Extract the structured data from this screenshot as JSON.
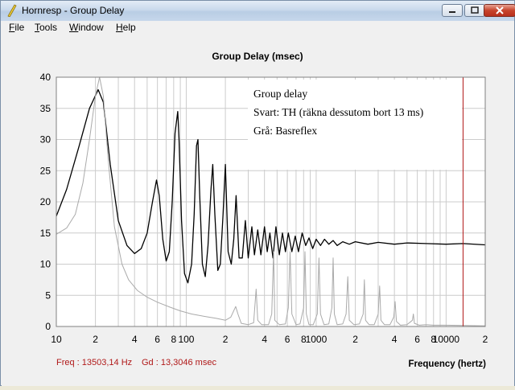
{
  "window": {
    "title": "Hornresp - Group Delay",
    "controls": {
      "minimize": "minimize-icon",
      "maximize": "maximize-icon",
      "close": "close-icon"
    }
  },
  "menu": {
    "file": {
      "label": "File",
      "first": "F",
      "rest": "ile"
    },
    "tools": {
      "label": "Tools",
      "first": "T",
      "rest": "ools"
    },
    "window": {
      "label": "Window",
      "first": "W",
      "rest": "indow"
    },
    "help": {
      "label": "Help",
      "first": "H",
      "rest": "elp"
    }
  },
  "annotation": {
    "line1": "Group delay",
    "line2": "Svart: TH (räkna dessutom bort 13 ms)",
    "line3": "Grå: Basreflex"
  },
  "readout": {
    "freq": "Freq : 13503,14 Hz",
    "gd": "Gd : 13,3046 msec"
  },
  "colors": {
    "plot_bg": "#ffffff",
    "grid": "#cccccc",
    "series_th": "#000000",
    "series_bassreflex": "#aaaaaa",
    "cursor": "#b01818",
    "readout": "#b01818"
  },
  "chart_data": {
    "type": "line",
    "title": "Group Delay (msec)",
    "xlabel": "Frequency (hertz)",
    "ylabel": "",
    "x_scale": "log",
    "xlim": [
      10,
      20000
    ],
    "ylim": [
      0,
      40
    ],
    "grid": true,
    "y_ticks": [
      "0",
      "5",
      "10",
      "15",
      "20",
      "25",
      "30",
      "35",
      "40"
    ],
    "x_tick_labels": [
      {
        "f": 10,
        "label": "10"
      },
      {
        "f": 20,
        "label": "2"
      },
      {
        "f": 40,
        "label": "4"
      },
      {
        "f": 60,
        "label": "6"
      },
      {
        "f": 80,
        "label": "8"
      },
      {
        "f": 100,
        "label": "100"
      },
      {
        "f": 200,
        "label": "2"
      },
      {
        "f": 400,
        "label": "4"
      },
      {
        "f": 600,
        "label": "6"
      },
      {
        "f": 800,
        "label": "8"
      },
      {
        "f": 1000,
        "label": "1000"
      },
      {
        "f": 2000,
        "label": "2"
      },
      {
        "f": 4000,
        "label": "4"
      },
      {
        "f": 6000,
        "label": "6"
      },
      {
        "f": 8000,
        "label": "8"
      },
      {
        "f": 10000,
        "label": "10000"
      },
      {
        "f": 20000,
        "label": "2"
      }
    ],
    "cursor_x": 13503.14,
    "series": [
      {
        "color": "#000000",
        "points": [
          [
            10,
            17.7
          ],
          [
            12,
            22
          ],
          [
            15,
            29
          ],
          [
            18,
            35
          ],
          [
            21,
            38
          ],
          [
            23,
            36
          ],
          [
            26,
            26
          ],
          [
            30,
            17
          ],
          [
            35,
            13
          ],
          [
            40,
            11.7
          ],
          [
            45,
            12.5
          ],
          [
            50,
            15
          ],
          [
            55,
            20
          ],
          [
            59,
            23.5
          ],
          [
            62,
            21
          ],
          [
            66,
            14
          ],
          [
            70,
            10.5
          ],
          [
            74,
            12
          ],
          [
            78,
            20
          ],
          [
            82,
            31
          ],
          [
            86,
            34.5
          ],
          [
            88,
            30
          ],
          [
            92,
            17
          ],
          [
            97,
            8.5
          ],
          [
            103,
            7
          ],
          [
            110,
            10
          ],
          [
            115,
            18
          ],
          [
            120,
            29
          ],
          [
            123,
            30
          ],
          [
            127,
            21
          ],
          [
            133,
            10
          ],
          [
            140,
            8
          ],
          [
            147,
            13
          ],
          [
            155,
            22
          ],
          [
            160,
            26
          ],
          [
            166,
            18
          ],
          [
            175,
            9
          ],
          [
            183,
            10
          ],
          [
            192,
            18
          ],
          [
            200,
            26
          ],
          [
            210,
            12
          ],
          [
            222,
            10
          ],
          [
            232,
            14
          ],
          [
            242,
            21
          ],
          [
            255,
            11
          ],
          [
            270,
            11
          ],
          [
            285,
            17
          ],
          [
            300,
            11
          ],
          [
            320,
            16
          ],
          [
            335,
            11.5
          ],
          [
            355,
            15.5
          ],
          [
            375,
            11.5
          ],
          [
            400,
            16
          ],
          [
            420,
            12
          ],
          [
            440,
            15
          ],
          [
            465,
            11
          ],
          [
            490,
            16
          ],
          [
            520,
            11.5
          ],
          [
            550,
            15
          ],
          [
            580,
            12
          ],
          [
            610,
            15
          ],
          [
            650,
            12
          ],
          [
            690,
            14.5
          ],
          [
            730,
            12
          ],
          [
            780,
            15
          ],
          [
            830,
            13
          ],
          [
            880,
            14.2
          ],
          [
            940,
            12.5
          ],
          [
            1000,
            14
          ],
          [
            1080,
            13
          ],
          [
            1160,
            14
          ],
          [
            1250,
            13.2
          ],
          [
            1350,
            13.8
          ],
          [
            1450,
            13
          ],
          [
            1600,
            13.6
          ],
          [
            1800,
            13.2
          ],
          [
            2000,
            13.6
          ],
          [
            2500,
            13.2
          ],
          [
            3000,
            13.5
          ],
          [
            4000,
            13.2
          ],
          [
            5000,
            13.4
          ],
          [
            7000,
            13.3
          ],
          [
            10000,
            13.2
          ],
          [
            13500,
            13.3
          ],
          [
            20000,
            13.1
          ]
        ]
      },
      {
        "color": "#aaaaaa",
        "points": [
          [
            10,
            14.8
          ],
          [
            12,
            15.8
          ],
          [
            14,
            18
          ],
          [
            16,
            23
          ],
          [
            18,
            30
          ],
          [
            20,
            37
          ],
          [
            21.5,
            40
          ],
          [
            23,
            37
          ],
          [
            25,
            27
          ],
          [
            28,
            16
          ],
          [
            32,
            10
          ],
          [
            36,
            7.5
          ],
          [
            42,
            5.8
          ],
          [
            50,
            4.7
          ],
          [
            60,
            3.9
          ],
          [
            75,
            3.1
          ],
          [
            90,
            2.5
          ],
          [
            110,
            2
          ],
          [
            140,
            1.6
          ],
          [
            170,
            1.3
          ],
          [
            200,
            1
          ],
          [
            220,
            1.5
          ],
          [
            240,
            3.2
          ],
          [
            250,
            2
          ],
          [
            265,
            0.5
          ],
          [
            300,
            0.3
          ],
          [
            330,
            0.6
          ],
          [
            345,
            6
          ],
          [
            355,
            1
          ],
          [
            380,
            0.3
          ],
          [
            430,
            0.3
          ],
          [
            455,
            2
          ],
          [
            470,
            12
          ],
          [
            480,
            1
          ],
          [
            520,
            0.3
          ],
          [
            580,
            0.4
          ],
          [
            610,
            3
          ],
          [
            630,
            12
          ],
          [
            650,
            2
          ],
          [
            700,
            0.3
          ],
          [
            750,
            0.4
          ],
          [
            800,
            3
          ],
          [
            820,
            12
          ],
          [
            840,
            2
          ],
          [
            880,
            0.3
          ],
          [
            950,
            0.3
          ],
          [
            1020,
            2
          ],
          [
            1050,
            11
          ],
          [
            1080,
            2
          ],
          [
            1150,
            0.3
          ],
          [
            1250,
            0.4
          ],
          [
            1320,
            3
          ],
          [
            1350,
            11
          ],
          [
            1380,
            2
          ],
          [
            1450,
            0.3
          ],
          [
            1600,
            0.4
          ],
          [
            1700,
            2
          ],
          [
            1750,
            8
          ],
          [
            1800,
            1
          ],
          [
            1950,
            0.3
          ],
          [
            2150,
            0.4
          ],
          [
            2300,
            2
          ],
          [
            2350,
            7.5
          ],
          [
            2400,
            1
          ],
          [
            2550,
            0.3
          ],
          [
            2800,
            0.3
          ],
          [
            3000,
            2
          ],
          [
            3080,
            6.5
          ],
          [
            3150,
            1
          ],
          [
            3350,
            0.3
          ],
          [
            3700,
            0.3
          ],
          [
            3950,
            1.5
          ],
          [
            4050,
            4
          ],
          [
            4150,
            0.8
          ],
          [
            4450,
            0.2
          ],
          [
            5000,
            0.3
          ],
          [
            5500,
            1
          ],
          [
            5600,
            2
          ],
          [
            5700,
            0.5
          ],
          [
            6200,
            0.2
          ],
          [
            7000,
            0.3
          ],
          [
            8000,
            0.2
          ],
          [
            10000,
            0.2
          ],
          [
            20000,
            0.1
          ]
        ]
      }
    ]
  }
}
